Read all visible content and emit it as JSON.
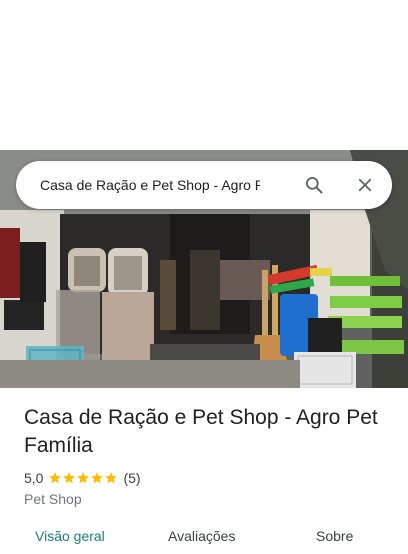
{
  "search": {
    "query": "Casa de Ração e Pet Shop - Agro Pet Família"
  },
  "place": {
    "title": "Casa de Ração e Pet Shop - Agro Pet Família",
    "rating": "5,0",
    "stars": 5,
    "review_count": "(5)",
    "category": "Pet Shop"
  },
  "tabs": [
    {
      "label": "Visão geral",
      "active": true
    },
    {
      "label": "Avaliações",
      "active": false
    },
    {
      "label": "Sobre",
      "active": false
    }
  ],
  "colors": {
    "star": "#fbbc04",
    "active_tab": "#1a7f75",
    "text_primary": "#202124",
    "text_secondary": "#70757a"
  },
  "icons": {
    "search": "search-icon",
    "close": "close-icon",
    "star": "star-icon"
  }
}
